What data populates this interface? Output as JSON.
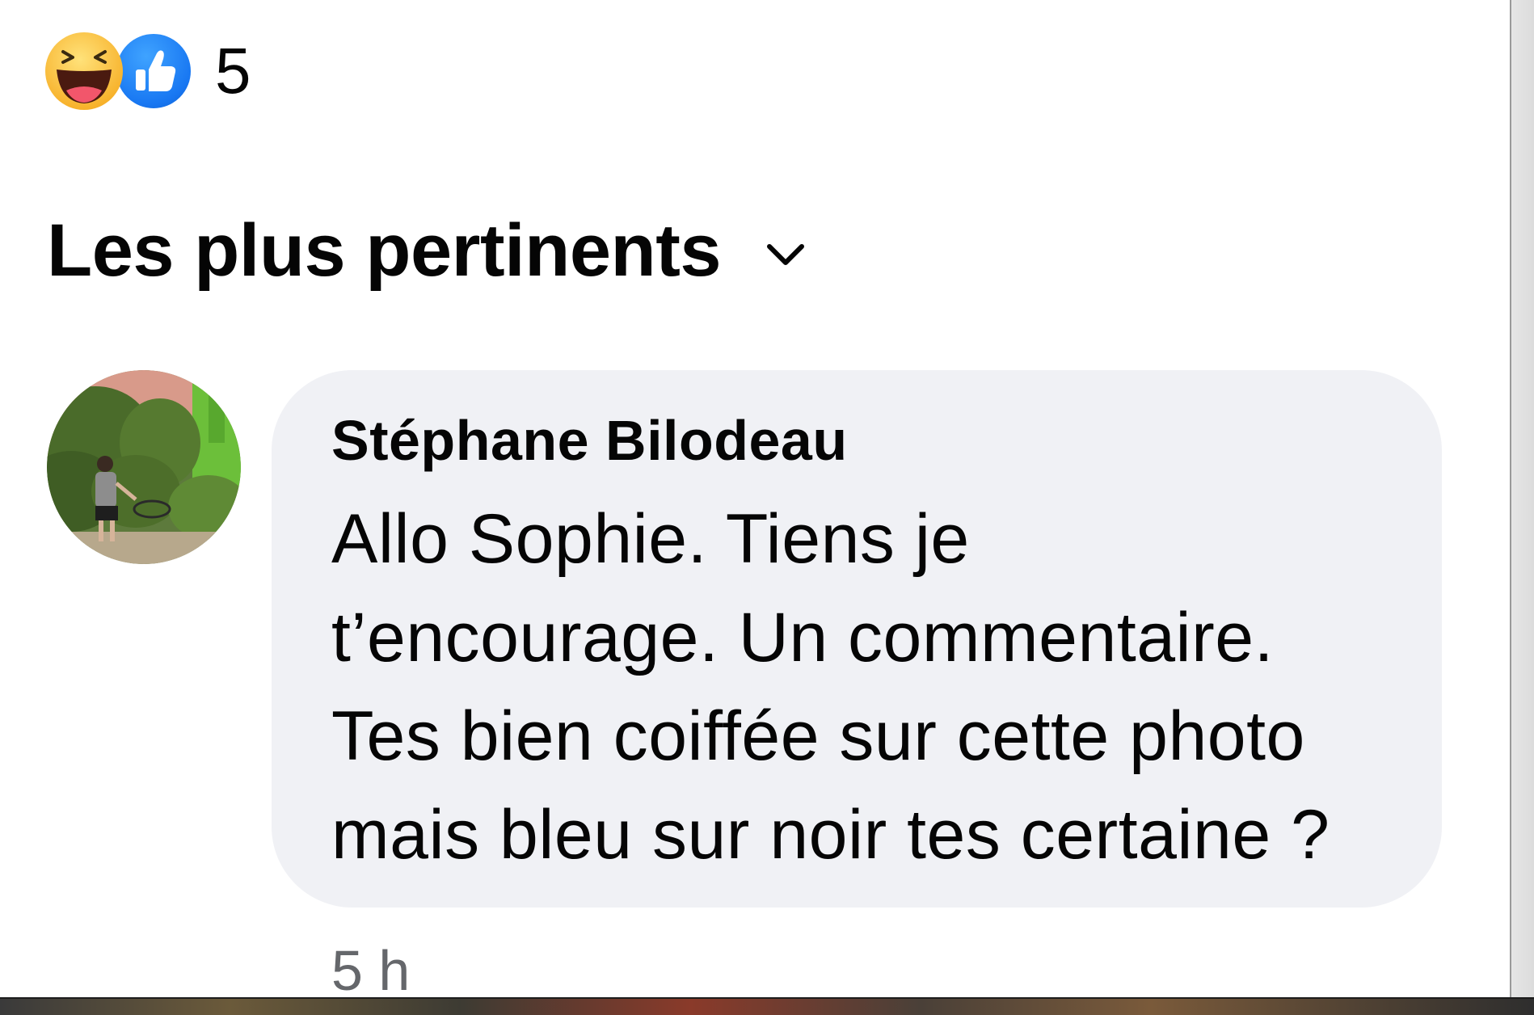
{
  "reactions": {
    "icons": [
      "haha-icon",
      "like-icon"
    ],
    "count": "5"
  },
  "sort": {
    "label": "Les plus pertinents",
    "icon": "chevron-down-icon"
  },
  "comment": {
    "author": "Stéphane Bilodeau",
    "text": "Allo Sophie. Tiens je\nt’encourage.   Un commentaire.\nTes bien coiffée sur cette photo\nmais bleu sur noir tes certaine ?",
    "timestamp": "5 h"
  },
  "colors": {
    "like_blue": "#1877f2",
    "haha_yellow": "#f7b12a",
    "bubble_bg": "#f0f1f5",
    "secondary_text": "#65676b"
  }
}
